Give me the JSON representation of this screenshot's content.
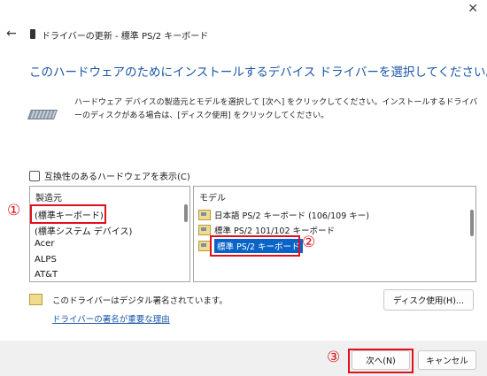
{
  "window": {
    "close_glyph": "✕",
    "back_glyph": "←",
    "title": "ドライバーの更新 - 標準 PS/2 キーボード"
  },
  "heading": "このハードウェアのためにインストールするデバイス ドライバーを選択してください。",
  "description": "ハードウェア デバイスの製造元とモデルを選択して [次へ] をクリックしてください。インストールするドライバーのディスクがある場合は、[ディスク使用] をクリックしてください。",
  "compat_checkbox": {
    "label": "互換性のあるハードウェアを表示(C)",
    "checked": false
  },
  "manufacturer": {
    "header": "製造元",
    "items": [
      "(標準キーボード)",
      "(標準システム デバイス)",
      "Acer",
      "ALPS",
      "AT&T"
    ]
  },
  "model": {
    "header": "モデル",
    "items": [
      "日本語 PS/2 キーボード (106/109 キー)",
      "標準 PS/2 101/102 キーボード",
      "標準 PS/2 キーボード"
    ]
  },
  "signature": {
    "text": "このドライバーはデジタル署名されています。",
    "link": "ドライバーの署名が重要な理由"
  },
  "buttons": {
    "disk": "ディスク使用(H)...",
    "next": "次へ(N)",
    "cancel": "キャンセル"
  },
  "annotations": {
    "step1": "①",
    "step2": "②",
    "step3": "③"
  },
  "icons": [
    "close-icon",
    "back-arrow-icon",
    "device-icon",
    "keyboard-icon",
    "driver-icon",
    "signature-icon"
  ],
  "colors": {
    "heading": "#1a56a8",
    "selection": "#0a64c8",
    "annotation": "#e0101c"
  }
}
